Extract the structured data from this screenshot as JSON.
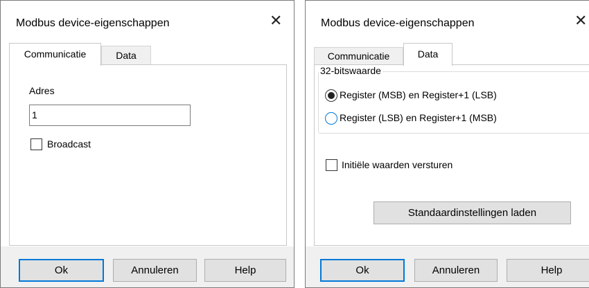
{
  "dialog1": {
    "title": "Modbus device-eigenschappen",
    "close_glyph": "✕",
    "tabs": [
      {
        "label": "Communicatie",
        "active": true
      },
      {
        "label": "Data",
        "active": false
      }
    ],
    "address_label": "Adres",
    "address_value": "1",
    "broadcast_label": "Broadcast",
    "broadcast_checked": false,
    "buttons": {
      "ok": "Ok",
      "cancel": "Annuleren",
      "help": "Help"
    }
  },
  "dialog2": {
    "title": "Modbus device-eigenschappen",
    "close_glyph": "✕",
    "tabs": [
      {
        "label": "Communicatie",
        "active": false
      },
      {
        "label": "Data",
        "active": true
      }
    ],
    "group_label": "32-bitswaarde",
    "radio_options": [
      {
        "label": "Register (MSB) en Register+1 (LSB)",
        "selected": true
      },
      {
        "label": "Register (LSB) en Register+1 (MSB)",
        "selected": false
      }
    ],
    "initial_values_label": "Initiële waarden versturen",
    "initial_values_checked": false,
    "load_defaults_label": "Standaardinstellingen laden",
    "buttons": {
      "ok": "Ok",
      "cancel": "Annuleren",
      "help": "Help"
    }
  },
  "colors": {
    "accent": "#0078d7",
    "footer_bg": "#f0f0f0",
    "button_bg": "#e1e1e1",
    "tab_inactive_bg": "#f0f0f0"
  }
}
